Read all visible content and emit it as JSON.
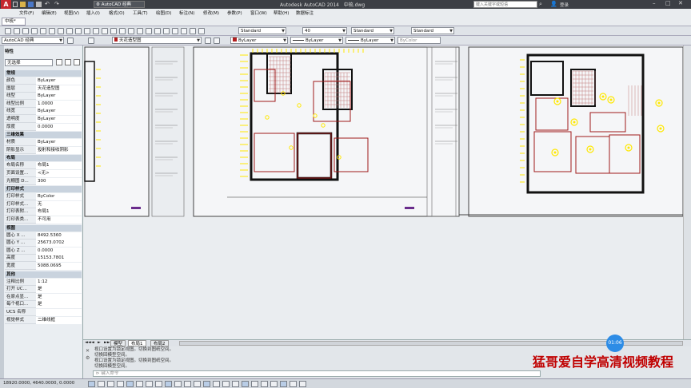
{
  "window": {
    "app_title": "Autodesk AutoCAD 2014",
    "file_name": "中梳.dwg",
    "quick_access_workspace": "AutoCAD 经典",
    "search_placeholder": "键入关键字或短语",
    "login_label": "登录"
  },
  "menu": {
    "items": [
      "文件(F)",
      "编辑(E)",
      "视图(V)",
      "插入(I)",
      "格式(O)",
      "工具(T)",
      "绘图(D)",
      "标注(N)",
      "修改(M)",
      "参数(P)",
      "窗口(W)",
      "帮助(H)",
      "数据标注"
    ]
  },
  "ribbon": {
    "tab_label": "中梳*",
    "text_style": "Standard",
    "dim_size": "40",
    "dim_style": "Standard",
    "table_style": "Standard"
  },
  "layers_toolbar": {
    "workspace": "AutoCAD 经典",
    "layer_name": "天花造型图",
    "color": "ByLayer",
    "linetype": "ByLayer",
    "lineweight": "ByLayer",
    "plotstyle": "ByColor"
  },
  "properties_panel": {
    "title": "特性",
    "selection": "无选择",
    "groups": [
      {
        "name": "常规",
        "rows": [
          {
            "key": "颜色",
            "value": "ByLayer"
          },
          {
            "key": "图层",
            "value": "天花造型图"
          },
          {
            "key": "线型",
            "value": "ByLayer"
          },
          {
            "key": "线型比例",
            "value": "1.0000"
          },
          {
            "key": "线宽",
            "value": "ByLayer"
          },
          {
            "key": "透明度",
            "value": "ByLayer"
          },
          {
            "key": "厚度",
            "value": "0.0000"
          }
        ]
      },
      {
        "name": "三维效果",
        "rows": [
          {
            "key": "材质",
            "value": "ByLayer"
          },
          {
            "key": "阴影显示",
            "value": "投射和接收阴影"
          }
        ]
      },
      {
        "name": "布局",
        "rows": [
          {
            "key": "布局名称",
            "value": "布局1"
          },
          {
            "key": "页面设置...",
            "value": "<无>"
          },
          {
            "key": "光栅图 D...",
            "value": "300"
          }
        ]
      },
      {
        "name": "打印样式",
        "rows": [
          {
            "key": "打印样式",
            "value": "ByColor"
          },
          {
            "key": "打印样式...",
            "value": "无"
          },
          {
            "key": "打印表附...",
            "value": "布局1"
          },
          {
            "key": "打印表类...",
            "value": "不可用"
          }
        ]
      },
      {
        "name": "视图",
        "rows": [
          {
            "key": "圆心 X ...",
            "value": "8492.5360"
          },
          {
            "key": "圆心 Y ...",
            "value": "25673.0702"
          },
          {
            "key": "圆心 Z ...",
            "value": "0.0000"
          },
          {
            "key": "高度",
            "value": "15153.7801"
          },
          {
            "key": "宽度",
            "value": "5088.0695"
          }
        ]
      },
      {
        "name": "其他",
        "rows": [
          {
            "key": "注释比例",
            "value": "1:12"
          },
          {
            "key": "打开 UC...",
            "value": "是"
          },
          {
            "key": "在原点显...",
            "value": "是"
          },
          {
            "key": "每个视口...",
            "value": "是"
          },
          {
            "key": "UCS 名称",
            "value": ""
          },
          {
            "key": "视觉样式",
            "value": "二维线框"
          }
        ]
      }
    ]
  },
  "layout_tabs": {
    "nav": [
      "◄◄",
      "◄",
      "►",
      "►►"
    ],
    "tabs": [
      "模型",
      "布局1",
      "布局2"
    ]
  },
  "command_line": {
    "history": [
      "视口设置为锁定视图。切换到图纸空间。",
      "切换回模型空间。",
      "视口设置为锁定视图。切换到图纸空间。",
      "切换回模型空间。"
    ],
    "prompt": "键入命令"
  },
  "status_bar": {
    "coords": "18920.0000, 4640.0000, 0.0000"
  },
  "video_overlay": {
    "timestamp": "01:06",
    "watermark": "猛哥爱自学高清视频教程"
  },
  "colors": {
    "wall": "#111111",
    "annotation": "#ffe800",
    "room_outline": "#a01a1a",
    "grid": "#c07a7a",
    "title_bar": "#3c3f45",
    "canvas": "#eaedf0",
    "timestamp_badge": "#2d8ce6"
  }
}
